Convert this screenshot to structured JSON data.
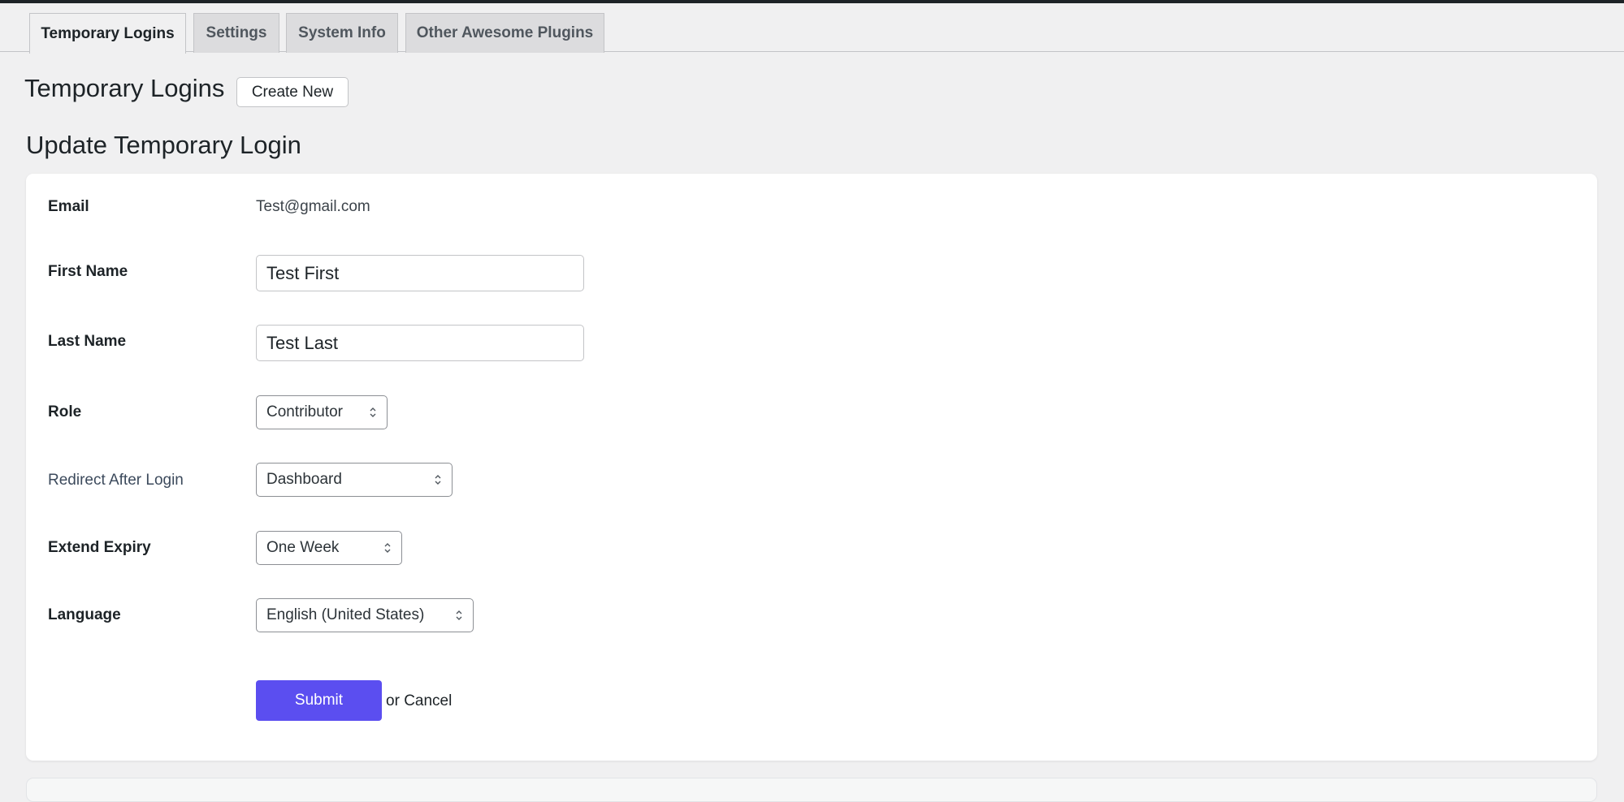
{
  "tabs": [
    {
      "label": "Temporary Logins",
      "active": true
    },
    {
      "label": "Settings",
      "active": false
    },
    {
      "label": "System Info",
      "active": false
    },
    {
      "label": "Other Awesome Plugins",
      "active": false
    }
  ],
  "header": {
    "title": "Temporary Logins",
    "create_label": "Create New"
  },
  "section_title": "Update Temporary Login",
  "form": {
    "email": {
      "label": "Email",
      "value": "Test@gmail.com"
    },
    "first_name": {
      "label": "First Name",
      "value": "Test First"
    },
    "last_name": {
      "label": "Last Name",
      "value": "Test Last"
    },
    "role": {
      "label": "Role",
      "selected": "Contributor"
    },
    "redirect": {
      "label": "Redirect After Login",
      "selected": "Dashboard"
    },
    "expiry": {
      "label": "Extend Expiry",
      "selected": "One Week"
    },
    "language": {
      "label": "Language",
      "selected": "English (United States)"
    },
    "submit_label": "Submit",
    "or_label": "or",
    "cancel_label": "Cancel"
  },
  "colors": {
    "accent": "#5b4ef0",
    "background": "#f0f0f1",
    "topbar": "#1d2327"
  },
  "icons": {
    "select_arrow": "chevron-up-down-icon"
  }
}
